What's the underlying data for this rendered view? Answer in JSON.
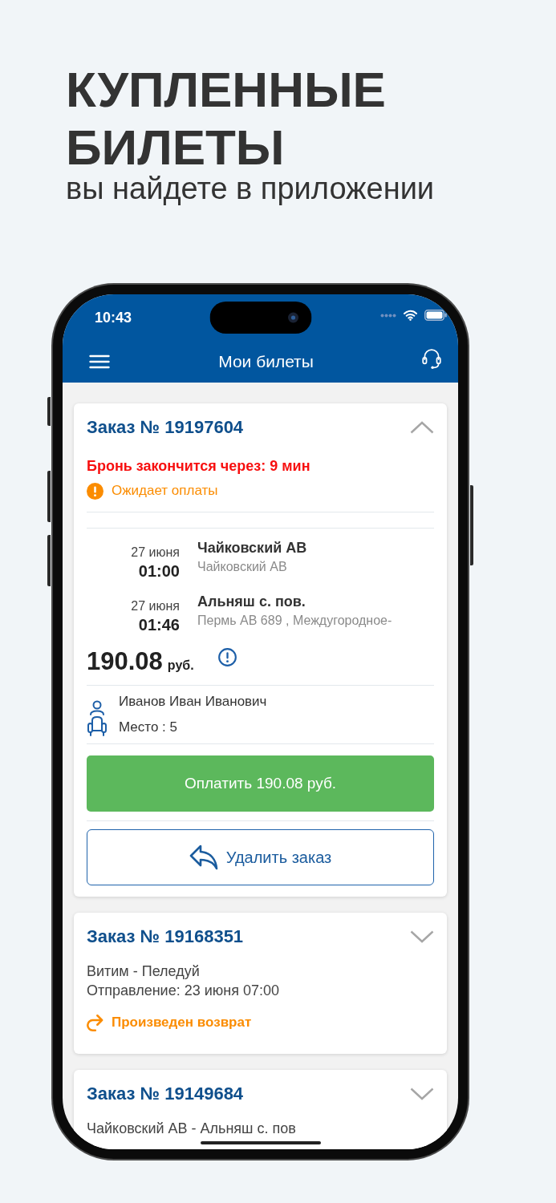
{
  "promo": {
    "headline": "КУПЛЕННЫЕ БИЛЕТЫ",
    "subtitle": "вы найдете в приложении"
  },
  "status_bar": {
    "time": "10:43"
  },
  "app_bar": {
    "title": "Мои билеты"
  },
  "orders": [
    {
      "title": "Заказ № 19197604",
      "expanded": true,
      "timer": "Бронь закончится через: 9 мин",
      "status": {
        "kind": "awaiting_payment",
        "text": "Ожидает оплаты"
      },
      "stops": [
        {
          "date": "27 июня",
          "time": "01:00",
          "name": "Чайковский АВ",
          "detail": "Чайковский АВ"
        },
        {
          "date": "27 июня",
          "time": "01:46",
          "name": "Альняш с. пов.",
          "detail": "Пермь АВ 689 , Междугородное-"
        }
      ],
      "price": {
        "amount": "190.08",
        "currency": "руб."
      },
      "passenger": {
        "name": "Иванов Иван Иванович",
        "seat": "Место : 5"
      },
      "actions": [
        {
          "kind": "pay",
          "label": "Оплатить 190.08 руб."
        },
        {
          "kind": "delete",
          "label": "Удалить заказ"
        }
      ]
    },
    {
      "title": "Заказ № 19168351",
      "expanded": false,
      "route": "Витим - Пеледуй",
      "departure": "Отправление: 23 июня 07:00",
      "status": {
        "kind": "refunded",
        "text": "Произведен возврат"
      }
    },
    {
      "title": "Заказ № 19149684",
      "expanded": false,
      "route": "Чайковский АВ - Альняш с. пов"
    }
  ]
}
